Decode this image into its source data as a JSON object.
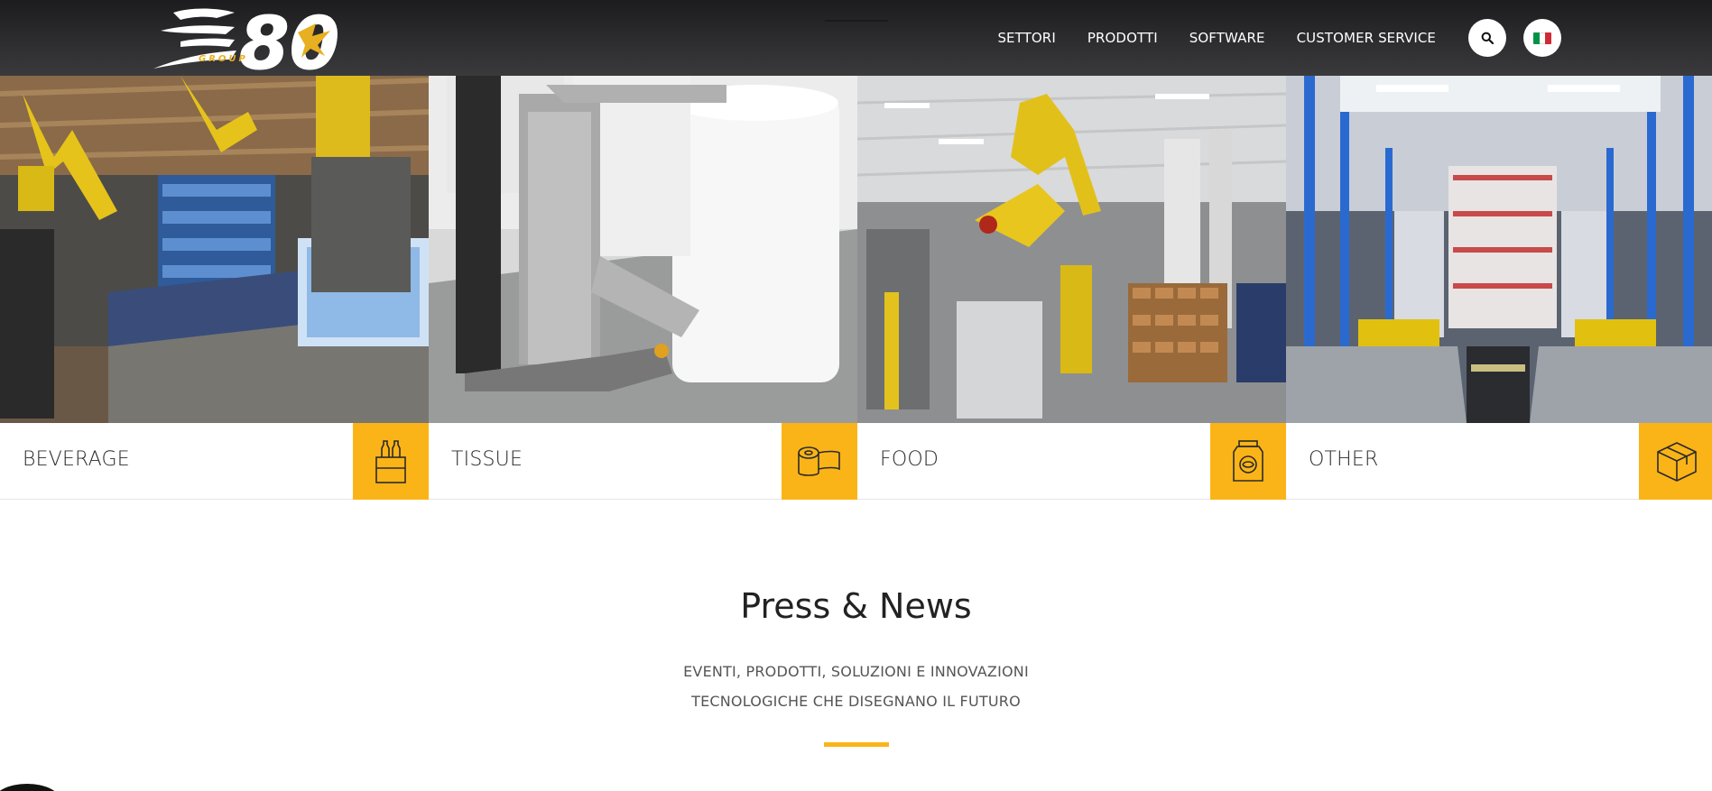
{
  "header": {
    "logo": {
      "text": "80",
      "sub": "GROUP",
      "icon": "eagle-logo"
    },
    "nav": [
      {
        "label": "SETTORI"
      },
      {
        "label": "PRODOTTI"
      },
      {
        "label": "SOFTWARE"
      },
      {
        "label": "CUSTOMER SERVICE"
      }
    ],
    "search_icon": "search-icon",
    "language": {
      "icon": "italian-flag-icon",
      "colors": [
        "#009246",
        "#ffffff",
        "#ce2b37"
      ]
    }
  },
  "sectors": [
    {
      "label": "BEVERAGE",
      "icon": "bottles-icon"
    },
    {
      "label": "TISSUE",
      "icon": "tissue-roll-icon"
    },
    {
      "label": "FOOD",
      "icon": "food-jar-icon"
    },
    {
      "label": "OTHER",
      "icon": "box-icon"
    }
  ],
  "press": {
    "title": "Press & News",
    "subtitle_line1": "EVENTI, PRODOTTI, SOLUZIONI E INNOVAZIONI",
    "subtitle_line2": "TECNOLOGICHE CHE DISEGNANO IL FUTURO"
  },
  "colors": {
    "accent": "#fbb417",
    "header_dark": "#2d2d30"
  }
}
